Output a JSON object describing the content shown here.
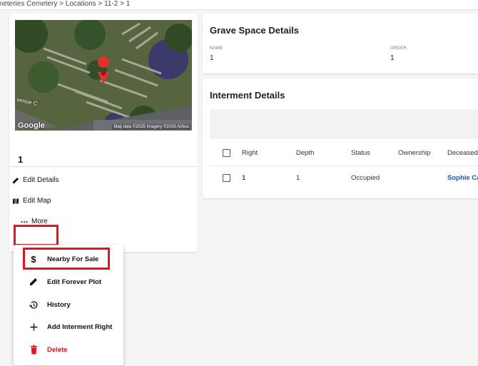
{
  "breadcrumb": {
    "text": "meteries Cemetery > Locations > 11-2 > 1"
  },
  "map": {
    "google_label": "Google",
    "credit": "Map data ©2025 Imagery ©2025 Airbus",
    "street_label": "venue C"
  },
  "plot": {
    "name": "1"
  },
  "actions": {
    "edit_details": "Edit Details",
    "edit_map": "Edit Map",
    "more": "More"
  },
  "menu": {
    "items": [
      {
        "label": "Nearby For Sale",
        "icon": "dollar-icon"
      },
      {
        "label": "Edit Forever Plot",
        "icon": "pencil-icon"
      },
      {
        "label": "History",
        "icon": "history-icon"
      },
      {
        "label": "Add Interment Right",
        "icon": "plus-icon"
      },
      {
        "label": "Delete",
        "icon": "trash-icon"
      }
    ]
  },
  "grave_space": {
    "title": "Grave Space Details",
    "fields": [
      {
        "label": "NAME",
        "value": "1"
      },
      {
        "label": "ORDER",
        "value": "1"
      }
    ]
  },
  "interment": {
    "title": "Interment Details",
    "columns": [
      "Right",
      "Depth",
      "Status",
      "Ownership",
      "Deceased"
    ],
    "rows": [
      {
        "right": "1",
        "depth": "1",
        "status": "Occupied",
        "ownership": "",
        "deceased": "Sophie Ca"
      }
    ]
  },
  "colors": {
    "accent_red": "#e3141b",
    "link_blue": "#1a56b8"
  }
}
